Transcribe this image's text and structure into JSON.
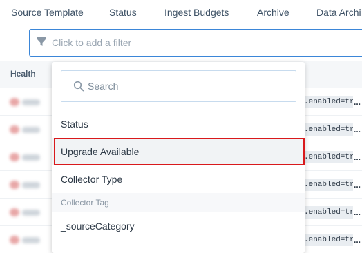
{
  "tabs": [
    {
      "label": "Source Template"
    },
    {
      "label": "Status"
    },
    {
      "label": "Ingest Budgets"
    },
    {
      "label": "Archive"
    },
    {
      "label": "Data Archi"
    }
  ],
  "filter": {
    "placeholder": "Click to add a filter",
    "icon": "funnel-icon"
  },
  "table": {
    "header": {
      "health": "Health"
    },
    "rows": [
      {
        "cell": ".enabled=tru",
        "more": "..."
      },
      {
        "cell": ".enabled=tru",
        "more": "..."
      },
      {
        "cell": ".enabled=tru",
        "more": "..."
      },
      {
        "cell": ".enabled=tru",
        "more": "..."
      },
      {
        "cell": ".enabled=tru",
        "more": "..."
      },
      {
        "cell": ".enabled=tru",
        "more": "..."
      }
    ]
  },
  "dropdown": {
    "search_placeholder": "Search",
    "options": [
      {
        "label": "Status"
      },
      {
        "label": "Upgrade Available"
      },
      {
        "label": "Collector Type"
      }
    ],
    "group_header": "Collector Tag",
    "group_options": [
      {
        "label": "_sourceCategory"
      }
    ]
  },
  "colors": {
    "accent": "#3b86d8",
    "highlight_outline": "#d9191c"
  }
}
